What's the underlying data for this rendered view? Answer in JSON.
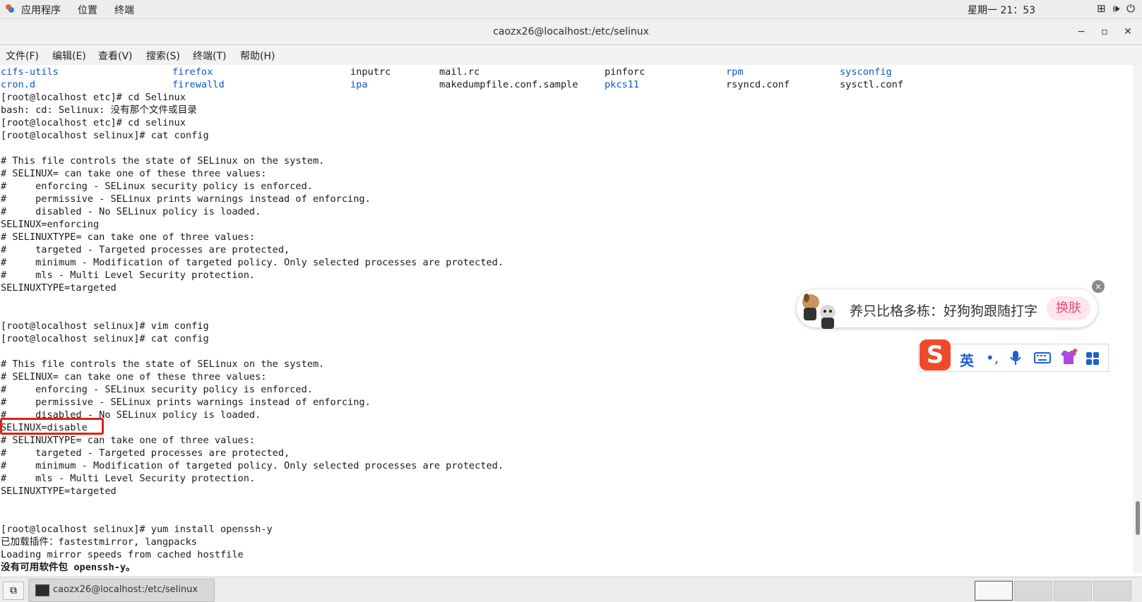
{
  "topbar": {
    "apps_label": "应用程序",
    "places_label": "位置",
    "terminal_label": "终端",
    "clock": "星期一 21：53"
  },
  "window": {
    "title": "caozx26@localhost:/etc/selinux",
    "minimize": "−",
    "maximize": "▫",
    "close": "✕"
  },
  "menu": [
    {
      "label": "文件(F)"
    },
    {
      "label": "编辑(E)"
    },
    {
      "label": "查看(V)"
    },
    {
      "label": "搜索(S)"
    },
    {
      "label": "终端(T)"
    },
    {
      "label": "帮助(H)"
    }
  ],
  "listing": [
    {
      "name": "cifs-utils",
      "type": "dir"
    },
    {
      "name": "firefox",
      "type": "dir"
    },
    {
      "name": "inputrc",
      "type": "file"
    },
    {
      "name": "mail.rc",
      "type": "file"
    },
    {
      "name": "pinforc",
      "type": "file"
    },
    {
      "name": "rpm",
      "type": "dir"
    },
    {
      "name": "sysconfig",
      "type": "dir"
    },
    {
      "name": "cron.d",
      "type": "dir"
    },
    {
      "name": "firewalld",
      "type": "dir"
    },
    {
      "name": "ipa",
      "type": "dir"
    },
    {
      "name": "makedumpfile.conf.sample",
      "type": "file"
    },
    {
      "name": "pkcs11",
      "type": "dir"
    },
    {
      "name": "rsyncd.conf",
      "type": "file"
    },
    {
      "name": "sysctl.conf",
      "type": "file"
    }
  ],
  "lines": [
    "[root@localhost etc]# cd Selinux",
    "bash: cd: Selinux: 没有那个文件或目录",
    "[root@localhost etc]# cd selinux",
    "[root@localhost selinux]# cat config",
    "",
    "# This file controls the state of SELinux on the system.",
    "# SELINUX= can take one of these three values:",
    "#     enforcing - SELinux security policy is enforced.",
    "#     permissive - SELinux prints warnings instead of enforcing.",
    "#     disabled - No SELinux policy is loaded.",
    "SELINUX=enforcing",
    "# SELINUXTYPE= can take one of three values:",
    "#     targeted - Targeted processes are protected,",
    "#     minimum - Modification of targeted policy. Only selected processes are protected.",
    "#     mls - Multi Level Security protection.",
    "SELINUXTYPE=targeted",
    "",
    "",
    "[root@localhost selinux]# vim config",
    "[root@localhost selinux]# cat config",
    "",
    "# This file controls the state of SELinux on the system.",
    "# SELINUX= can take one of these three values:",
    "#     enforcing - SELinux security policy is enforced.",
    "#     permissive - SELinux prints warnings instead of enforcing.",
    "#     disabled - No SELinux policy is loaded.",
    "SELINUX=disable",
    "# SELINUXTYPE= can take one of three values:",
    "#     targeted - Targeted processes are protected,",
    "#     minimum - Modification of targeted policy. Only selected processes are protected.",
    "#     mls - Multi Level Security protection.",
    "SELINUXTYPE=targeted",
    "",
    "",
    "[root@localhost selinux]# yum install openssh-y",
    "已加载插件：fastestmirror, langpacks",
    "Loading mirror speeds from cached hostfile",
    "没有可用软件包 openssh-y。"
  ],
  "ime": {
    "news_text": "养只比格多栋：好狗狗跟随打字",
    "skin_label": "换肤",
    "close": "×",
    "logo": "S",
    "lang": "英",
    "punct": "•,",
    "mic_icon": "microphone-icon",
    "keyboard_icon": "keyboard-icon",
    "shirt_icon": "shirt-icon",
    "grid_icon": "grid-icon"
  },
  "taskbar": {
    "item_label": "caozx26@localhost:/etc/selinux"
  },
  "colors": {
    "dir": "#1155cc",
    "highlight": "#e0201a",
    "ime_logo": "#f04a2b",
    "ime_blue": "#1f5fd1"
  }
}
